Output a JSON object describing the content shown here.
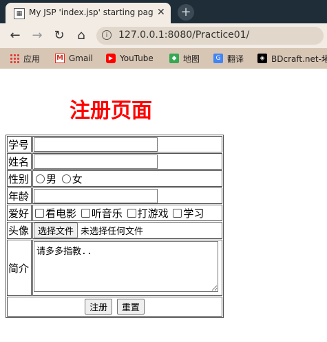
{
  "browser": {
    "tab_title": "My JSP 'index.jsp' starting page",
    "tab_close": "✕",
    "new_tab": "+",
    "back": "←",
    "forward": "→",
    "reload": "↻",
    "home": "⌂",
    "url": "127.0.0.1:8080/Practice01/",
    "bookmarks": [
      {
        "label": "应用",
        "icon": "apps-icon"
      },
      {
        "label": "Gmail",
        "icon": "gmail-icon"
      },
      {
        "label": "YouTube",
        "icon": "youtube-icon"
      },
      {
        "label": "地图",
        "icon": "maps-icon"
      },
      {
        "label": "翻译",
        "icon": "translate-icon"
      },
      {
        "label": "BDcraft.net-堵",
        "icon": "bdcraft-icon"
      }
    ]
  },
  "page": {
    "heading": "注册页面",
    "form": {
      "student_id_label": "学号",
      "name_label": "姓名",
      "gender_label": "性别",
      "gender_male": "男",
      "gender_female": "女",
      "age_label": "年龄",
      "hobby_label": "爱好",
      "hobbies": [
        "看电影",
        "听音乐",
        "打游戏",
        "学习"
      ],
      "avatar_label": "头像",
      "file_button": "选择文件",
      "file_status": "未选择任何文件",
      "bio_label": "简介",
      "bio_value": "请多多指教..",
      "submit": "注册",
      "reset": "重置"
    }
  }
}
